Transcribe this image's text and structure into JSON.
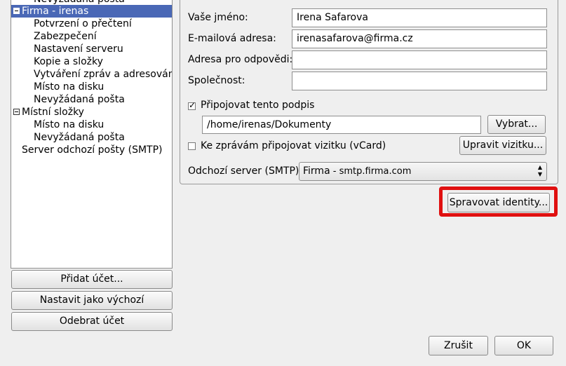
{
  "tree": {
    "items": [
      {
        "label": "Nevyžádaná pošta",
        "level": 1
      },
      {
        "label": "Firma - irenas",
        "level": 0,
        "selected": true,
        "expanded": true
      },
      {
        "label": "Potvrzení o přečtení",
        "level": 1
      },
      {
        "label": "Zabezpečení",
        "level": 1
      },
      {
        "label": "Nastavení serveru",
        "level": 1
      },
      {
        "label": "Kopie a složky",
        "level": 1
      },
      {
        "label": "Vytváření zpráv a adresování",
        "level": 1
      },
      {
        "label": "Místo na disku",
        "level": 1
      },
      {
        "label": "Nevyžádaná pošta",
        "level": 1
      },
      {
        "label": "Místní složky",
        "level": 0,
        "expanded": true
      },
      {
        "label": "Místo na disku",
        "level": 1
      },
      {
        "label": "Nevyžádaná pošta",
        "level": 1
      },
      {
        "label": "Server odchozí pošty (SMTP)",
        "level": 0
      }
    ]
  },
  "left_buttons": {
    "add_account": "Přidat účet...",
    "set_default": "Nastavit jako výchozí",
    "remove_account": "Odebrat účet"
  },
  "form": {
    "name_label": "Vaše jméno:",
    "name_value": "Irena Safarova",
    "email_label": "E-mailová adresa:",
    "email_value": "irenasafarova@firma.cz",
    "reply_label": "Adresa pro odpovědi:",
    "reply_value": "",
    "org_label": "Společnost:",
    "org_value": "",
    "signature_label": "Připojovat tento podpis",
    "signature_checked": true,
    "signature_path": "/home/irenas/Dokumenty",
    "choose_button": "Vybrat...",
    "vcard_label": "Ke zprávám připojovat vizitku (vCard)",
    "vcard_checked": false,
    "edit_vcard_button": "Upravit vizitku...",
    "smtp_label": "Odchozí server (SMTP)",
    "smtp_account": "Firma",
    "smtp_host": " - smtp.firma.com"
  },
  "manage_identities_button": "Spravovat identity...",
  "dialog": {
    "cancel": "Zrušit",
    "ok": "OK"
  },
  "colors": {
    "selection": "#4a68b6",
    "highlight_box": "#e01010",
    "background": "#efefef"
  }
}
